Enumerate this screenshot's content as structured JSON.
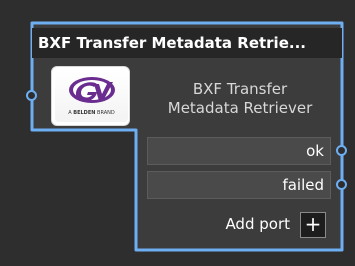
{
  "node": {
    "title": "BXF Transfer Metadata Retrie...",
    "label_line1": "BXF Transfer",
    "label_line2": "Metadata Retriever",
    "logo": {
      "icon": "gv-logo-icon",
      "sub_prefix": "A ",
      "sub_brand": "BELDEN",
      "sub_suffix": " BRAND"
    },
    "ports": {
      "input_icon": "input-port-dot",
      "outputs": [
        {
          "label": "ok"
        },
        {
          "label": "failed"
        }
      ]
    },
    "add_port": {
      "label": "Add port",
      "button_symbol": "+"
    }
  },
  "colors": {
    "background": "#2e2e2e",
    "node_border": "#6eaef3",
    "node_body": "#3c3c3c",
    "title_bar": "#262626",
    "port_field": "#4a4a4a",
    "logo_purple": "#6b2c8f"
  }
}
